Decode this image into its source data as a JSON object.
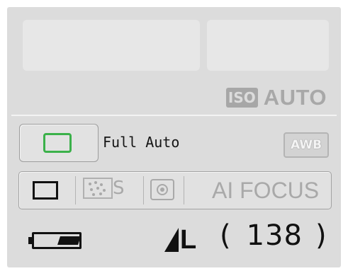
{
  "iso": {
    "badge": "ISO",
    "value": "AUTO"
  },
  "shooting_mode": {
    "label": "Full Auto",
    "icon": "scene-intelligent-auto-icon",
    "icon_color": "#3bb14a"
  },
  "white_balance": {
    "label": "AWB"
  },
  "settings_bar": {
    "drive_icon": "single-shot-icon",
    "picture_style": {
      "label": "S",
      "icon": "picture-style-standard-icon"
    },
    "metering_icon": "evaluative-metering-icon",
    "af_mode": "AI FOCUS"
  },
  "status": {
    "battery_icon": "battery-icon",
    "battery_level": 0.5,
    "image_quality": {
      "icon": "large-fine-icon",
      "size": "L"
    },
    "shots": {
      "open": "(",
      "count": "138",
      "close": ")"
    }
  }
}
